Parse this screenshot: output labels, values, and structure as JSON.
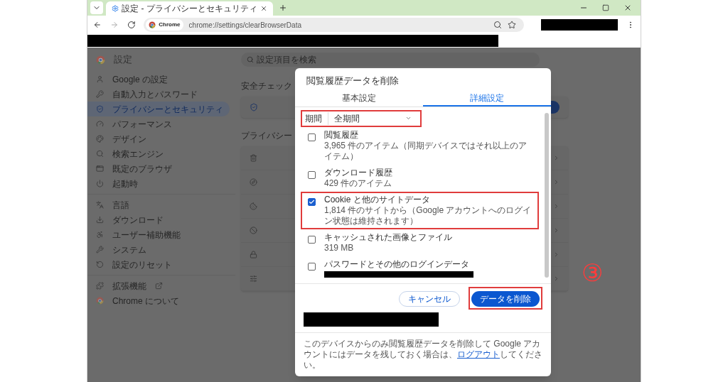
{
  "tab_bar": {
    "tab_title": "設定 - プライバシーとセキュリティ"
  },
  "address_bar": {
    "chip": "Chrome",
    "url": "chrome://settings/clearBrowserData"
  },
  "settings": {
    "title": "設定",
    "search_placeholder": "設定項目を検索",
    "sidebar": [
      [
        {
          "label": "Google の設定",
          "selected": false,
          "external": false
        },
        {
          "label": "自動入力とパスワード",
          "selected": false,
          "external": false
        },
        {
          "label": "プライバシーとセキュリティ",
          "selected": true,
          "external": false
        },
        {
          "label": "パフォーマンス",
          "selected": false,
          "external": false
        },
        {
          "label": "デザイン",
          "selected": false,
          "external": false
        },
        {
          "label": "検索エンジン",
          "selected": false,
          "external": false
        },
        {
          "label": "既定のブラウザ",
          "selected": false,
          "external": false
        },
        {
          "label": "起動時",
          "selected": false,
          "external": false
        }
      ],
      [
        {
          "label": "言語",
          "selected": false,
          "external": false
        },
        {
          "label": "ダウンロード",
          "selected": false,
          "external": false
        },
        {
          "label": "ユーザー補助機能",
          "selected": false,
          "external": false
        },
        {
          "label": "システム",
          "selected": false,
          "external": false
        },
        {
          "label": "設定のリセット",
          "selected": false,
          "external": false
        }
      ],
      [
        {
          "label": "拡張機能",
          "selected": false,
          "external": true
        },
        {
          "label": "Chrome について",
          "selected": false,
          "external": false
        }
      ]
    ],
    "safety_heading": "安全チェック",
    "privacy_heading": "プライバシー"
  },
  "dialog": {
    "title": "閲覧履歴データを削除",
    "tabs": [
      {
        "label": "基本設定",
        "selected": false
      },
      {
        "label": "詳細設定",
        "selected": true
      }
    ],
    "period": {
      "label": "期間",
      "value": "全期間",
      "highlighted": true
    },
    "items": [
      {
        "title": "閲覧履歴",
        "detail": "3,965 件のアイテム（同期デバイスではそれ以上のアイテム）",
        "checked": false,
        "highlighted": false,
        "redacted": false
      },
      {
        "title": "ダウンロード履歴",
        "detail": "429 件のアイテム",
        "checked": false,
        "highlighted": false,
        "redacted": false
      },
      {
        "title": "Cookie と他のサイトデータ",
        "detail": "1,814 件のサイトから（Google アカウントへのログイン状態は維持されます）",
        "checked": true,
        "highlighted": true,
        "redacted": false
      },
      {
        "title": "キャッシュされた画像とファイル",
        "detail": "319 MB",
        "checked": false,
        "highlighted": false,
        "redacted": false
      },
      {
        "title": "パスワードとその他のログインデータ",
        "checked": false,
        "highlighted": false,
        "redacted": true
      }
    ],
    "buttons": [
      {
        "label": "キャンセル",
        "kind": "secondary",
        "highlighted": false
      },
      {
        "label": "データを削除",
        "kind": "primary",
        "highlighted": true
      }
    ],
    "footer": "このデバイスからのみ閲覧履歴データを削除して Google アカウントにはデータを残しておく場合は、",
    "footer_link": "ログアウト",
    "footer_end": "してください。"
  },
  "annotation": {
    "step_marker": "③"
  }
}
